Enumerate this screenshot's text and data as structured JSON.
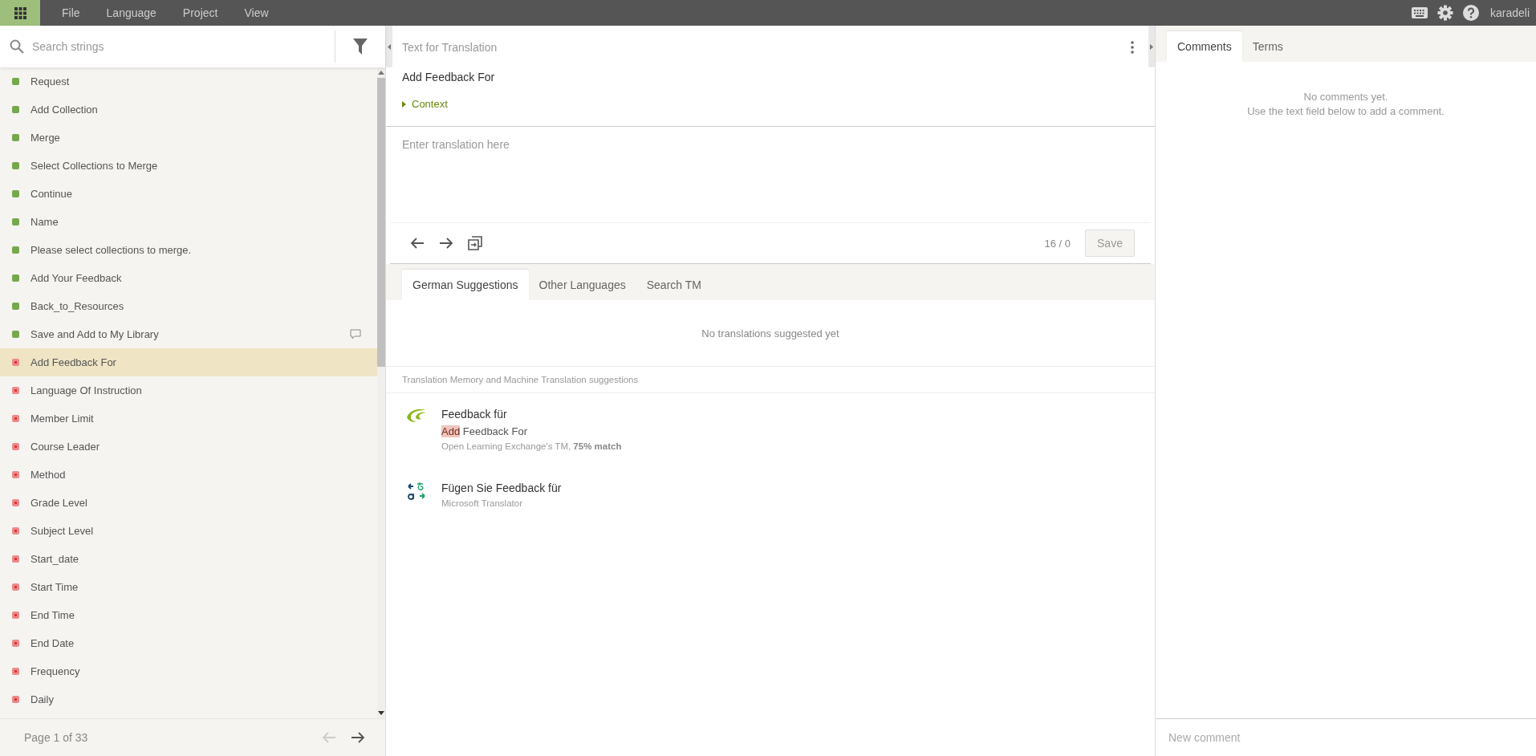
{
  "menu": [
    "File",
    "Language",
    "Project",
    "View"
  ],
  "user": "karadeli",
  "search": {
    "placeholder": "Search strings"
  },
  "strings": [
    {
      "text": "Request",
      "translated": true,
      "selected": false,
      "has_comment": false
    },
    {
      "text": "Add Collection",
      "translated": true,
      "selected": false,
      "has_comment": false
    },
    {
      "text": "Merge",
      "translated": true,
      "selected": false,
      "has_comment": false
    },
    {
      "text": "Select Collections to Merge",
      "translated": true,
      "selected": false,
      "has_comment": false
    },
    {
      "text": "Continue",
      "translated": true,
      "selected": false,
      "has_comment": false
    },
    {
      "text": "Name",
      "translated": true,
      "selected": false,
      "has_comment": false
    },
    {
      "text": "Please select collections to merge.",
      "translated": true,
      "selected": false,
      "has_comment": false
    },
    {
      "text": "Add Your Feedback",
      "translated": true,
      "selected": false,
      "has_comment": false
    },
    {
      "text": "Back_to_Resources",
      "translated": true,
      "selected": false,
      "has_comment": false
    },
    {
      "text": "Save and Add to My Library",
      "translated": true,
      "selected": false,
      "has_comment": true
    },
    {
      "text": "Add Feedback For",
      "translated": false,
      "selected": true,
      "has_comment": false
    },
    {
      "text": "Language Of Instruction",
      "translated": false,
      "selected": false,
      "has_comment": false
    },
    {
      "text": "Member Limit",
      "translated": false,
      "selected": false,
      "has_comment": false
    },
    {
      "text": "Course Leader",
      "translated": false,
      "selected": false,
      "has_comment": false
    },
    {
      "text": "Method",
      "translated": false,
      "selected": false,
      "has_comment": false
    },
    {
      "text": "Grade Level",
      "translated": false,
      "selected": false,
      "has_comment": false
    },
    {
      "text": "Subject Level",
      "translated": false,
      "selected": false,
      "has_comment": false
    },
    {
      "text": "Start_date",
      "translated": false,
      "selected": false,
      "has_comment": false
    },
    {
      "text": "Start Time",
      "translated": false,
      "selected": false,
      "has_comment": false
    },
    {
      "text": "End Time",
      "translated": false,
      "selected": false,
      "has_comment": false
    },
    {
      "text": "End Date",
      "translated": false,
      "selected": false,
      "has_comment": false
    },
    {
      "text": "Frequency",
      "translated": false,
      "selected": false,
      "has_comment": false
    },
    {
      "text": "Daily",
      "translated": false,
      "selected": false,
      "has_comment": false
    }
  ],
  "pagination": {
    "label": "Page 1 of 33",
    "prev_disabled": true,
    "next_disabled": false
  },
  "source": {
    "heading": "Text for Translation",
    "text": "Add Feedback For",
    "context_label": "Context",
    "context_expanded": false
  },
  "editor": {
    "placeholder": "Enter translation here",
    "counter": "16 / 0",
    "save_label": "Save",
    "save_disabled": true
  },
  "suggestion_tabs": [
    {
      "label": "German Suggestions",
      "selected": true
    },
    {
      "label": "Other Languages",
      "selected": false
    },
    {
      "label": "Search TM",
      "selected": false
    }
  ],
  "no_suggestions": "No translations suggested yet",
  "tm_heading": "Translation Memory and Machine Translation suggestions",
  "suggestions": [
    {
      "kind": "tm",
      "translation": "Feedback für",
      "source_segments": [
        {
          "text": "Add",
          "removed": true
        },
        {
          "text": " Feedback For",
          "removed": false
        }
      ],
      "origin": "Open Learning Exchange's TM, **75% match**"
    },
    {
      "kind": "mt",
      "translation": "Fügen Sie Feedback für",
      "origin": "Microsoft Translator"
    }
  ],
  "side_tabs": [
    {
      "label": "Comments",
      "selected": true
    },
    {
      "label": "Terms",
      "selected": false
    }
  ],
  "comments_empty": [
    "No comments yet.",
    "Use the text field below to add a comment."
  ],
  "comment_field": {
    "placeholder": "New comment"
  }
}
